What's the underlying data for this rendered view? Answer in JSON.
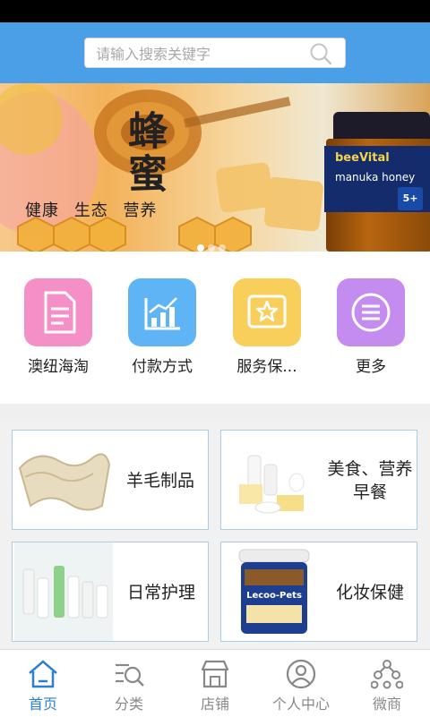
{
  "search": {
    "placeholder": "请输入搜索关键字"
  },
  "banner": {
    "title": "蜂蜜",
    "tagline": "健康 生态 营养",
    "jar_brand": "beeVital",
    "jar_sub": "manuka honey",
    "jar_badge": "5+",
    "slides": 3,
    "active_slide": 1
  },
  "categories": [
    {
      "label": "澳纽海淘",
      "icon": "document-icon",
      "color": "#f48fc8"
    },
    {
      "label": "付款方式",
      "icon": "chart-icon",
      "color": "#5fb4f5"
    },
    {
      "label": "服务保...",
      "icon": "star-badge-icon",
      "color": "#f7cf5a"
    },
    {
      "label": "更多",
      "icon": "menu-icon",
      "color": "#c58cf0"
    }
  ],
  "products": [
    {
      "label": "羊毛制品"
    },
    {
      "label": "美食、营养早餐"
    },
    {
      "label": "日常护理"
    },
    {
      "label": "化妆保健"
    }
  ],
  "tabs": [
    {
      "label": "首页",
      "icon": "home-icon",
      "active": true
    },
    {
      "label": "分类",
      "icon": "category-search-icon",
      "active": false
    },
    {
      "label": "店铺",
      "icon": "store-icon",
      "active": false
    },
    {
      "label": "个人中心",
      "icon": "user-icon",
      "active": false
    },
    {
      "label": "微商",
      "icon": "network-icon",
      "active": false
    }
  ],
  "colors": {
    "header": "#4a9fe6",
    "active_tab": "#2f7fcf",
    "tile_border": "#a9cde8"
  }
}
